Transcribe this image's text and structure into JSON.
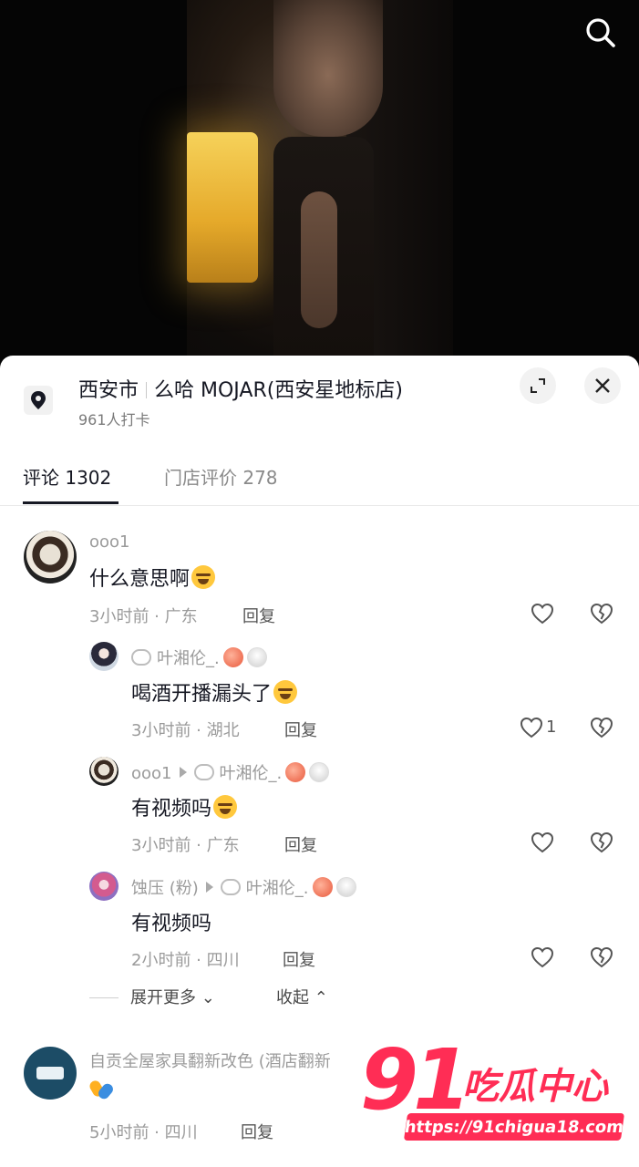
{
  "location": {
    "city": "西安市",
    "place": "么哈 MOJAR(西安星地标店)",
    "checkins": "961人打卡",
    "icons": [
      "location-pin-icon",
      "expand-icon",
      "close-icon",
      "search-icon"
    ]
  },
  "tabs": [
    {
      "label": "评论 1302",
      "active": true
    },
    {
      "label": "门店评价 278",
      "active": false
    }
  ],
  "comments": [
    {
      "user": "ooo1",
      "text": "什么意思啊",
      "meta": "3小时前 · 广东",
      "reply": "回复",
      "replies": [
        {
          "user": "叶湘伦_.",
          "text": "喝酒开播漏头了",
          "meta": "3小时前 · 湖北",
          "reply": "回复",
          "likes": "1"
        },
        {
          "user": "ooo1",
          "reply_to": "叶湘伦_.",
          "text": "有视频吗",
          "meta": "3小时前 · 广东",
          "reply": "回复"
        },
        {
          "user": "蚀压 (粉)",
          "reply_to": "叶湘伦_.",
          "text": "有视频吗",
          "meta": "2小时前 · 四川",
          "reply": "回复"
        }
      ],
      "expand_more": "展开更多",
      "collapse": "收起"
    },
    {
      "user": "自贡全屋家具翻新改色 (酒店翻新",
      "text": "",
      "meta": "5小时前 · 四川",
      "reply": "回复"
    }
  ],
  "watermark": {
    "number": "91",
    "text": "吃瓜中心",
    "url": "https://91chigua18.com"
  },
  "colors": {
    "primary_text": "#161823",
    "secondary_text": "#9b9b9b",
    "watermark": "#ff2d55"
  }
}
